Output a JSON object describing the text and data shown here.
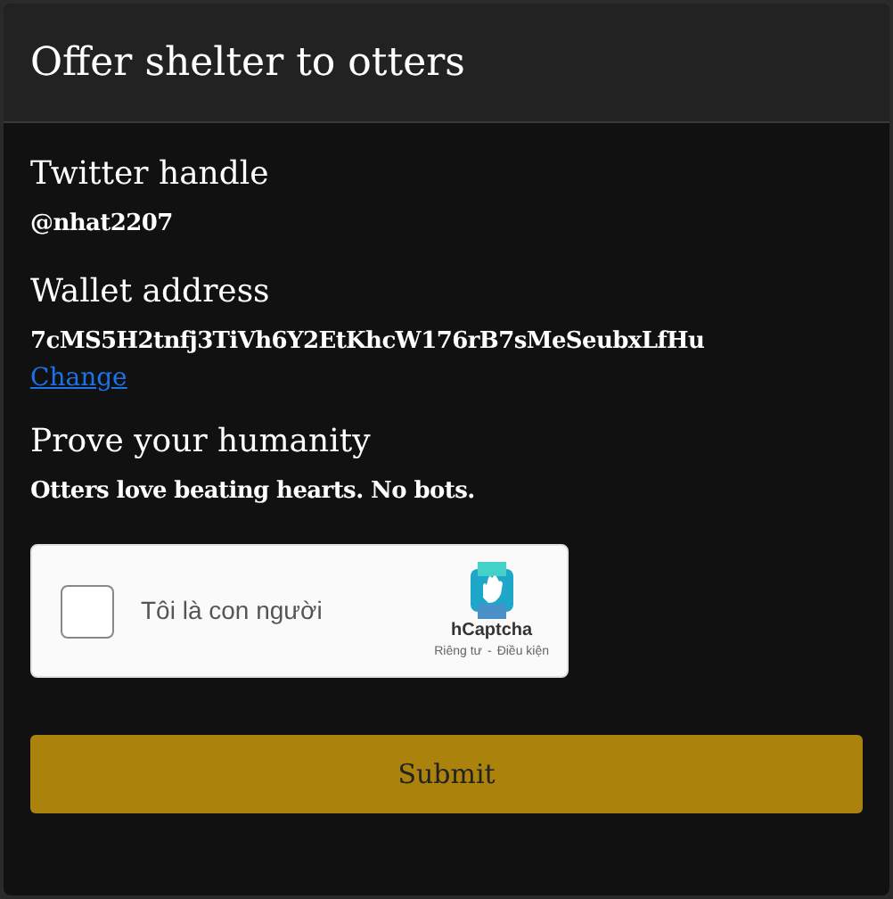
{
  "dialog": {
    "title": "Offer shelter to otters"
  },
  "sections": [
    {
      "heading": "Twitter handle",
      "value": "@nhat2207"
    },
    {
      "heading": "Wallet address",
      "value": "7cMS5H2tnfj3TiVh6Y2EtKhcW176rB7sMeSeubxLfHu",
      "link": "Change"
    },
    {
      "heading": "Prove your humanity",
      "value": "Otters love beating hearts. No bots."
    }
  ],
  "captcha": {
    "checked": false,
    "label": "Tôi là con người",
    "brand": "hCaptcha",
    "privacy": "Riêng tư",
    "separator": "-",
    "terms": "Điều kiện"
  },
  "submit": "Submit"
}
